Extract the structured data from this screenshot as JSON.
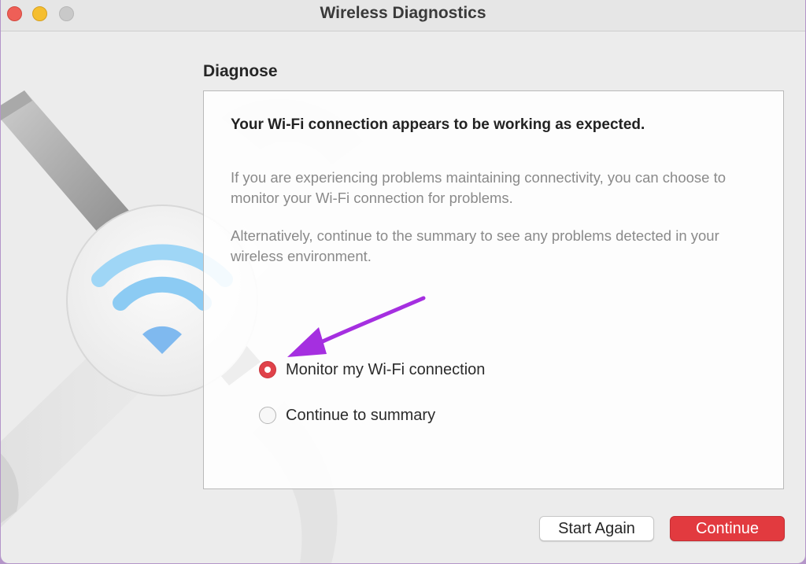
{
  "window": {
    "title": "Wireless Diagnostics"
  },
  "section": {
    "title": "Diagnose"
  },
  "panel": {
    "headline": "Your Wi-Fi connection appears to be working as expected.",
    "paragraph_1": "If you are experiencing problems maintaining connectivity, you can choose to monitor your Wi-Fi connection for problems.",
    "paragraph_2": "Alternatively, continue to the summary to see any problems detected in your wireless environment."
  },
  "options": [
    {
      "label": "Monitor my Wi-Fi connection",
      "selected": true
    },
    {
      "label": "Continue to summary",
      "selected": false
    }
  ],
  "buttons": {
    "start_again": "Start Again",
    "continue": "Continue"
  },
  "colors": {
    "accent": "#e23a3f",
    "annotation_arrow": "#a52fe0",
    "wifi_icon": "#7cc4f2"
  },
  "icons": {
    "app_artwork": "wrench-wifi-icon",
    "annotation": "arrow-annotation"
  }
}
